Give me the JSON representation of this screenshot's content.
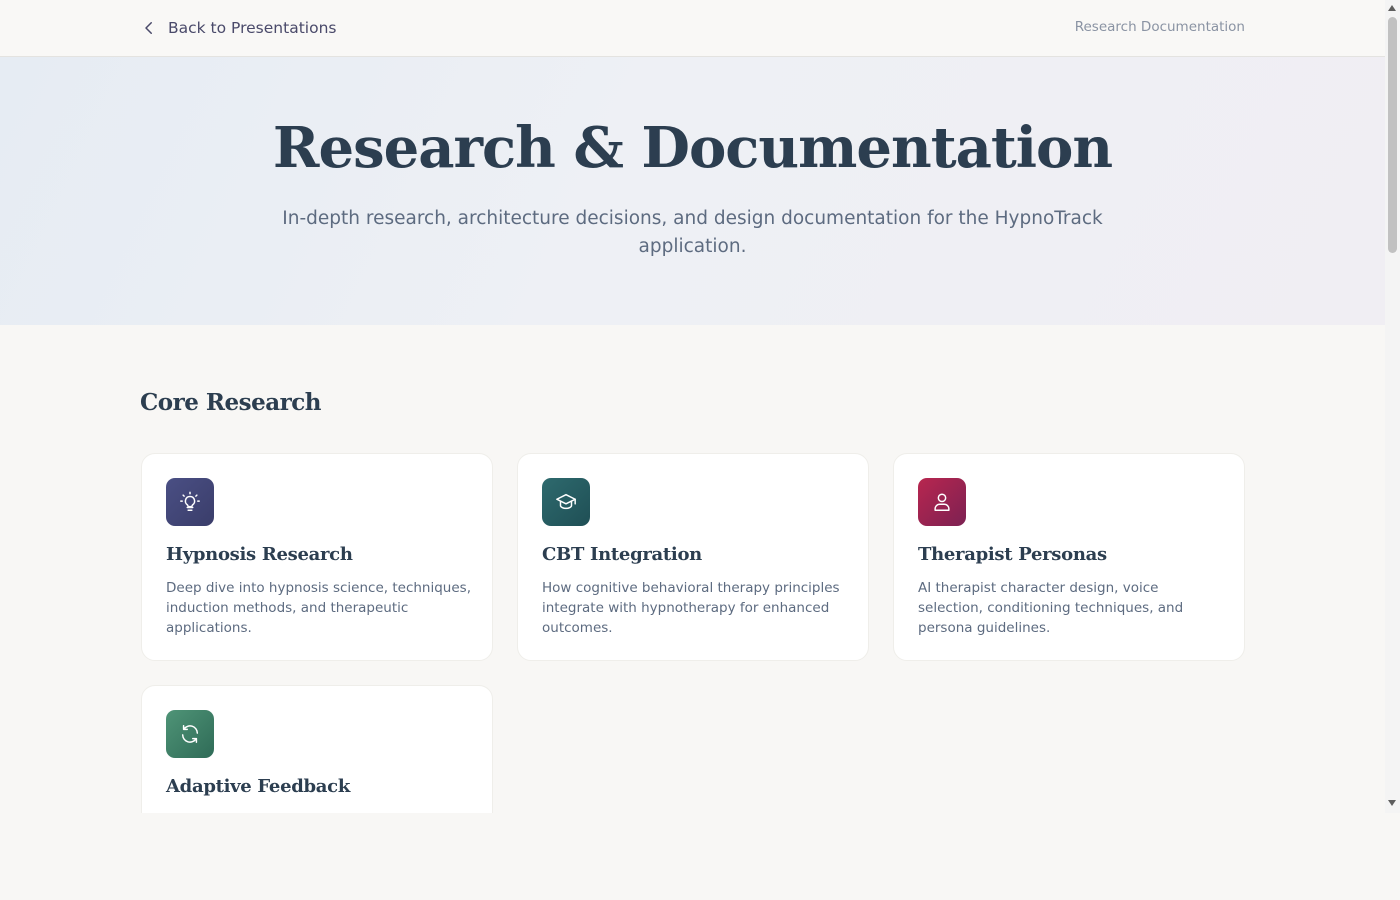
{
  "topbar": {
    "back_label": "Back to Presentations",
    "right_label": "Research Documentation"
  },
  "hero": {
    "title": "Research & Documentation",
    "subtitle": "In-depth research, architecture decisions, and design documentation for the HypnoTrack application."
  },
  "section": {
    "title": "Core Research"
  },
  "cards": [
    {
      "title": "Hypnosis Research",
      "description": "Deep dive into hypnosis science, techniques, induction methods, and therapeutic applications.",
      "icon": "lightbulb-icon",
      "color": "#44487a"
    },
    {
      "title": "CBT Integration",
      "description": "How cognitive behavioral therapy principles integrate with hypnotherapy for enhanced outcomes.",
      "icon": "graduation-cap-icon",
      "color": "#285c62"
    },
    {
      "title": "Therapist Personas",
      "description": "AI therapist character design, voice selection, conditioning techniques, and persona guidelines.",
      "icon": "user-icon",
      "color": "#9e2450"
    },
    {
      "title": "Adaptive Feedback",
      "description": "",
      "icon": "refresh-icon",
      "color": "#3f7f66"
    }
  ]
}
